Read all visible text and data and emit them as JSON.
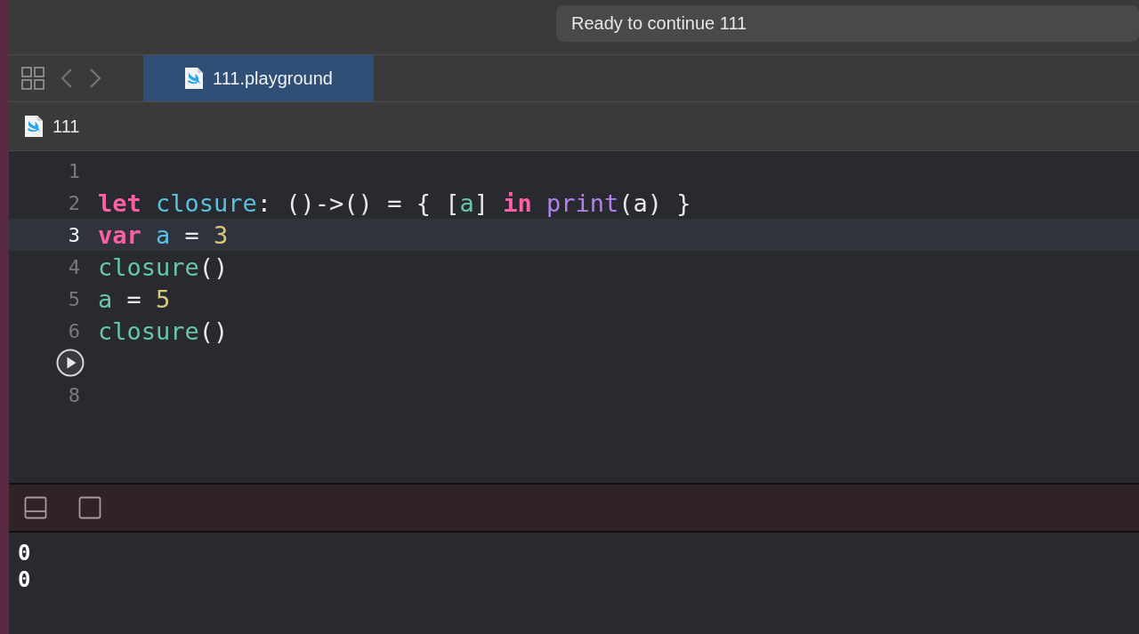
{
  "toolbar": {
    "status": "Ready to continue 111"
  },
  "tabs": [
    {
      "label": "111.playground",
      "selected": true
    }
  ],
  "jump_bar": {
    "path": "111"
  },
  "editor": {
    "lines": [
      {
        "kind": "code",
        "number": "1",
        "current": false
      },
      {
        "kind": "code",
        "number": "2",
        "current": false,
        "tokens": [
          {
            "text": "let",
            "kind": "keyword"
          },
          {
            "text": " closure",
            "kind": "decl"
          },
          {
            "text": ": ()->() = { [",
            "kind": "plain"
          },
          {
            "text": "a",
            "kind": "ref"
          },
          {
            "text": "] ",
            "kind": "plain"
          },
          {
            "text": "in",
            "kind": "keyword"
          },
          {
            "text": " print",
            "kind": "func"
          },
          {
            "text": "(a) }",
            "kind": "plain"
          }
        ]
      },
      {
        "kind": "code",
        "number": "3",
        "current": true,
        "tokens": [
          {
            "text": "var",
            "kind": "keyword"
          },
          {
            "text": " a",
            "kind": "decl"
          },
          {
            "text": " = ",
            "kind": "plain"
          },
          {
            "text": "3",
            "kind": "number"
          }
        ]
      },
      {
        "kind": "code",
        "number": "4",
        "current": false,
        "tokens": [
          {
            "text": "closure",
            "kind": "ref"
          },
          {
            "text": "()",
            "kind": "plain"
          }
        ]
      },
      {
        "kind": "code",
        "number": "5",
        "current": false,
        "tokens": [
          {
            "text": "a",
            "kind": "ref"
          },
          {
            "text": " = ",
            "kind": "plain"
          },
          {
            "text": "5",
            "kind": "number"
          }
        ]
      },
      {
        "kind": "code",
        "number": "6",
        "current": false,
        "tokens": [
          {
            "text": "closure",
            "kind": "ref"
          },
          {
            "text": "()",
            "kind": "plain"
          }
        ]
      },
      {
        "kind": "run",
        "current": false
      },
      {
        "kind": "code",
        "number": "8",
        "current": false
      }
    ]
  },
  "console": {
    "output": [
      "0",
      "0"
    ]
  }
}
